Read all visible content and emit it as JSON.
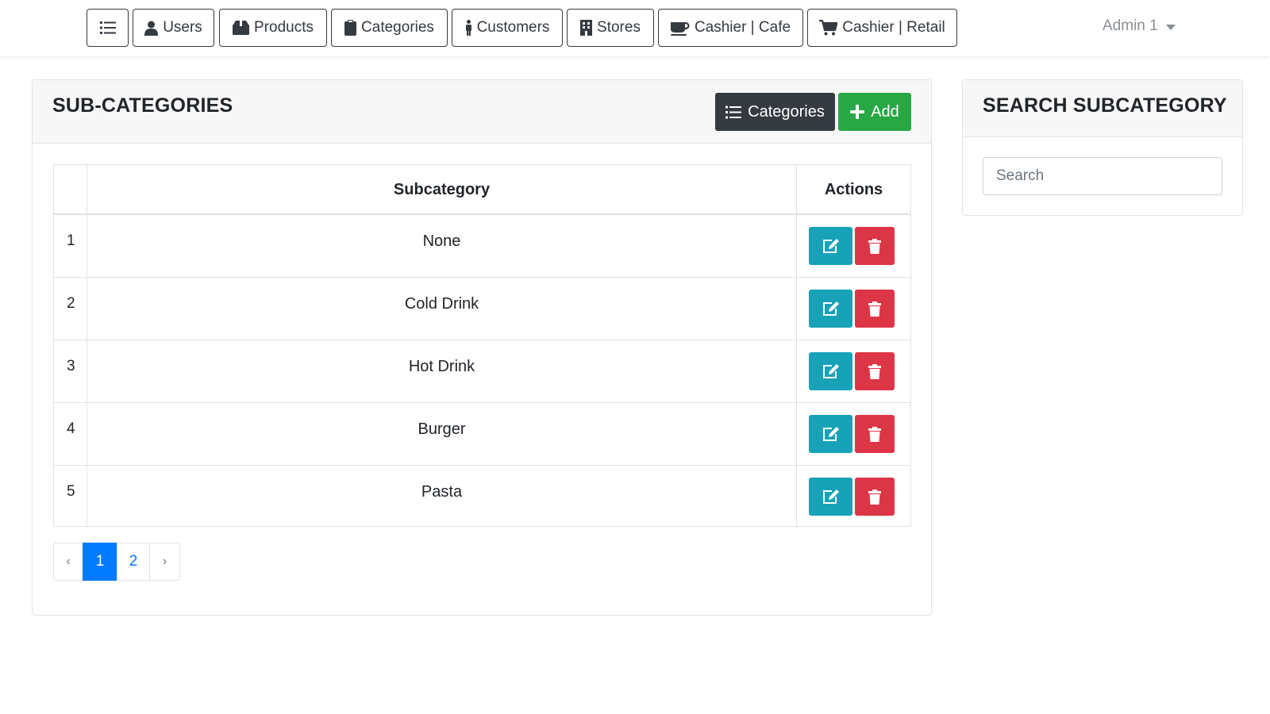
{
  "nav": {
    "items": [
      {
        "label": "",
        "icon": "list-icon"
      },
      {
        "label": "Users",
        "icon": "user-icon"
      },
      {
        "label": "Products",
        "icon": "box-icon"
      },
      {
        "label": "Categories",
        "icon": "clipboard-icon"
      },
      {
        "label": "Customers",
        "icon": "person-icon"
      },
      {
        "label": "Stores",
        "icon": "building-icon"
      },
      {
        "label": "Cashier | Cafe",
        "icon": "coffee-icon"
      },
      {
        "label": "Cashier | Retail",
        "icon": "cart-icon"
      }
    ],
    "user": "Admin 1"
  },
  "main": {
    "title": "SUB-CATEGORIES",
    "categories_button": "Categories",
    "add_button": "Add",
    "table": {
      "headers": [
        "",
        "Subcategory",
        "Actions"
      ],
      "rows": [
        {
          "num": "1",
          "name": "None"
        },
        {
          "num": "2",
          "name": "Cold Drink"
        },
        {
          "num": "3",
          "name": "Hot Drink"
        },
        {
          "num": "4",
          "name": "Burger"
        },
        {
          "num": "5",
          "name": "Pasta"
        }
      ]
    },
    "pagination": {
      "prev": "‹",
      "pages": [
        "1",
        "2"
      ],
      "next": "›",
      "active": "1"
    }
  },
  "search": {
    "title": "SEARCH SUBCATEGORY",
    "placeholder": "Search"
  },
  "colors": {
    "primary": "#007bff",
    "dark": "#343a40",
    "success": "#28a745",
    "info": "#17a2b8",
    "danger": "#dc3545"
  }
}
